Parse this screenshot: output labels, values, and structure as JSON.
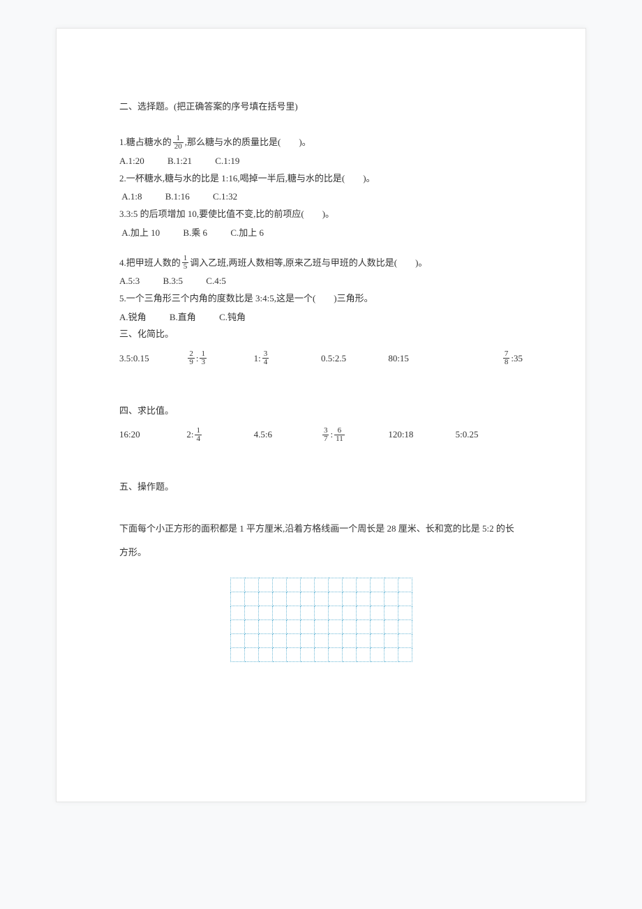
{
  "section2": {
    "title": "二、选择题。(把正确答案的序号填在括号里)",
    "q1": {
      "pre": "1.糖占糖水的",
      "frac_num": "1",
      "frac_den": "20",
      "post": ",那么糖与水的质量比是(　　)。",
      "opts": {
        "a": "A.1:20",
        "b": "B.1:21",
        "c": "C.1:19"
      }
    },
    "q2": {
      "text": "2.一杯糖水,糖与水的比是 1:16,喝掉一半后,糖与水的比是(　　)。",
      "opts": {
        "a": "A.1:8",
        "b": "B.1:16",
        "c": "C.1:32"
      }
    },
    "q3": {
      "text": "3.3:5 的后项增加 10,要使比值不变,比的前项应(　　)。",
      "opts": {
        "a": "A.加上 10",
        "b": "B.乘 6",
        "c": "C.加上 6"
      }
    },
    "q4": {
      "pre": "4.把甲班人数的",
      "frac_num": "1",
      "frac_den": "5",
      "post": "调入乙班,两班人数相等,原来乙班与甲班的人数比是(　　)。",
      "opts": {
        "a": "A.5:3",
        "b": "B.3:5",
        "c": "C.4:5"
      }
    },
    "q5": {
      "text": "5.一个三角形三个内角的度数比是 3:4:5,这是一个(　　)三角形。",
      "opts": {
        "a": "A.锐角",
        "b": "B.直角",
        "c": "C.钝角"
      }
    }
  },
  "section3": {
    "title": "三、化简比。",
    "items": {
      "e1": "3.5:0.15",
      "e2a_num": "2",
      "e2a_den": "9",
      "e2b_num": "1",
      "e2b_den": "3",
      "e3_pre": "1:",
      "e3_num": "3",
      "e3_den": "4",
      "e4": "0.5:2.5",
      "e5": "80:15",
      "e6_num": "7",
      "e6_den": "8",
      "e6_post": ":35"
    }
  },
  "section4": {
    "title": "四、求比值。",
    "items": {
      "e1": "16:20",
      "e2_pre": "2:",
      "e2_num": "1",
      "e2_den": "4",
      "e3": "4.5:6",
      "e4a_num": "3",
      "e4a_den": "7",
      "e4b_num": "6",
      "e4b_den": "11",
      "e5": "120:18",
      "e6": "5:0.25"
    }
  },
  "section5": {
    "title": "五、操作题。",
    "text": "下面每个小正方形的面积都是 1 平方厘米,沿着方格线画一个周长是 28 厘米、长和宽的比是 5:2 的长方形。",
    "grid": {
      "rows": 6,
      "cols": 13
    }
  }
}
